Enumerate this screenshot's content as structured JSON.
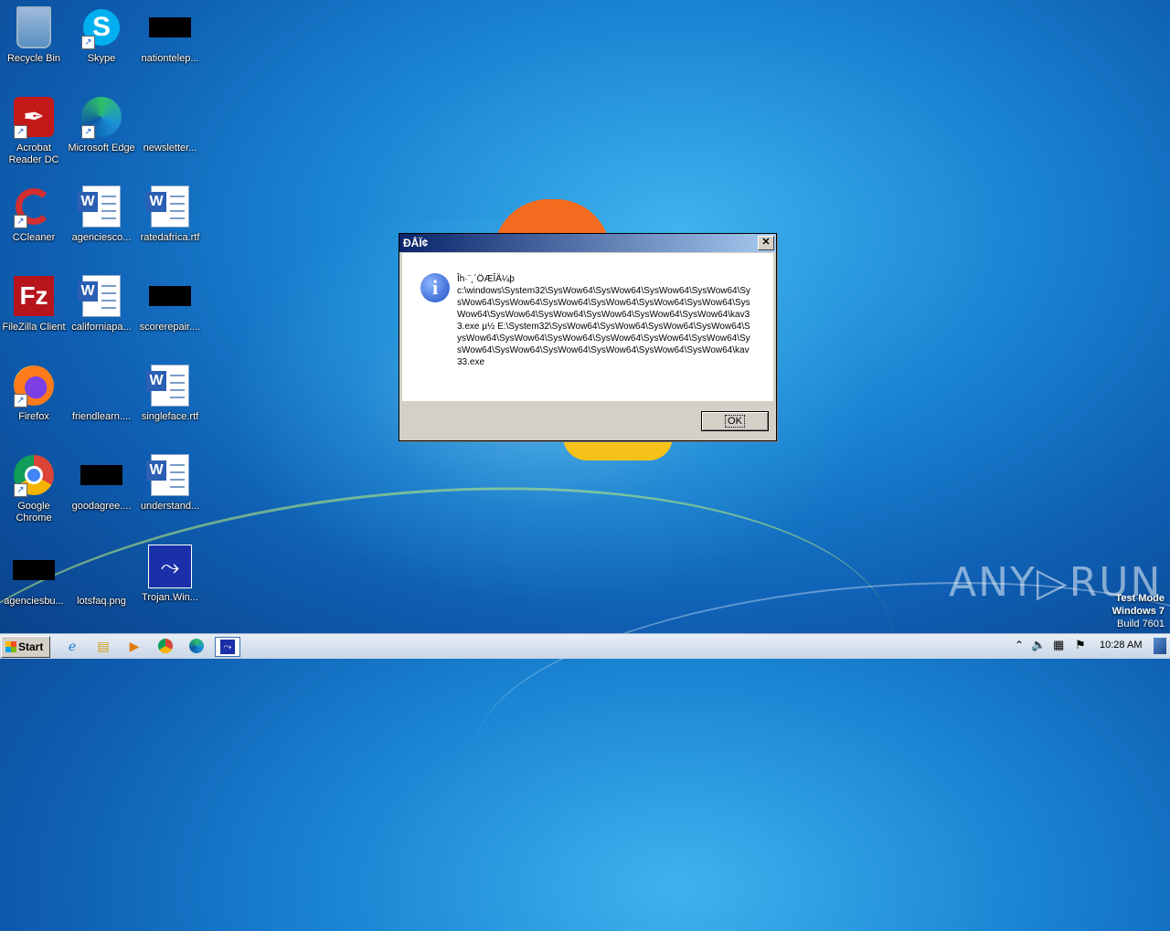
{
  "desktop": {
    "icons": [
      {
        "label": "Recycle Bin",
        "icon": "recycle-bin-icon"
      },
      {
        "label": "Skype",
        "icon": "skype-icon"
      },
      {
        "label": "nationtelep...",
        "icon": "redacted-file-icon"
      },
      {
        "label": "Acrobat Reader DC",
        "icon": "acrobat-icon"
      },
      {
        "label": "Microsoft Edge",
        "icon": "edge-icon"
      },
      {
        "label": "newsletter...",
        "icon": "blank-file-icon"
      },
      {
        "label": "CCleaner",
        "icon": "ccleaner-icon"
      },
      {
        "label": "agenciesco...",
        "icon": "word-doc-icon"
      },
      {
        "label": "ratedafrica.rtf",
        "icon": "word-doc-icon"
      },
      {
        "label": "FileZilla Client",
        "icon": "filezilla-icon"
      },
      {
        "label": "californiapa...",
        "icon": "word-doc-icon"
      },
      {
        "label": "scorerepair....",
        "icon": "redacted-file-icon"
      },
      {
        "label": "Firefox",
        "icon": "firefox-icon"
      },
      {
        "label": "friendlearn....",
        "icon": "blank-file-icon"
      },
      {
        "label": "singleface.rtf",
        "icon": "word-doc-icon"
      },
      {
        "label": "Google Chrome",
        "icon": "chrome-icon"
      },
      {
        "label": "goodagree....",
        "icon": "redacted-file-icon"
      },
      {
        "label": "understand...",
        "icon": "word-doc-icon"
      },
      {
        "label": "agenciesbu...",
        "icon": "redacted-file-icon"
      },
      {
        "label": "lotsfaq.png",
        "icon": "blank-file-icon"
      },
      {
        "label": "Trojan.Win...",
        "icon": "trojan-exe-icon"
      }
    ]
  },
  "dialog": {
    "title": "ÐÅÏ¢",
    "message_line1": "Îһ·¨¸´ÖÆÎÄ¼þ",
    "message_body": "c:\\windows\\System32\\SysWow64\\SysWow64\\SysWow64\\SysWow64\\SysWow64\\SysWow64\\SysWow64\\SysWow64\\SysWow64\\SysWow64\\SysWow64\\SysWow64\\SysWow64\\SysWow64\\SysWow64\\SysWow64\\kav33.exe µ½ E:\\System32\\SysWow64\\SysWow64\\SysWow64\\SysWow64\\SysWow64\\SysWow64\\SysWow64\\SysWow64\\SysWow64\\SysWow64\\SysWow64\\SysWow64\\SysWow64\\SysWow64\\SysWow64\\SysWow64\\kav33.exe",
    "ok_label": "OK",
    "close_glyph": "✕"
  },
  "watermark": {
    "brand": "ANY▷RUN"
  },
  "os_notice": {
    "line1": "Test Mode",
    "line2": "Windows 7",
    "line3": "Build 7601"
  },
  "taskbar": {
    "start_label": "Start",
    "pinned": [
      "ie-icon",
      "explorer-icon",
      "media-player-icon",
      "chrome-icon",
      "edge-icon",
      "trojan-task-icon"
    ],
    "clock": "10:28 AM"
  }
}
